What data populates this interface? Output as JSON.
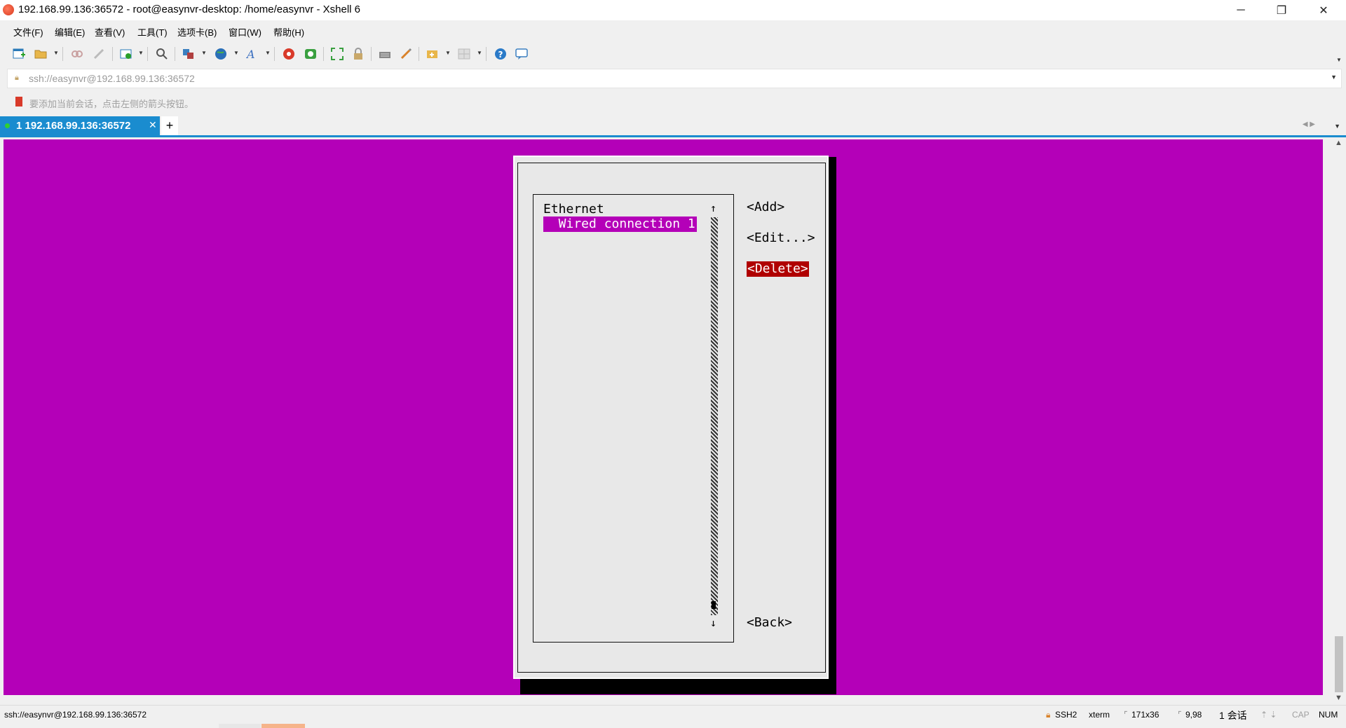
{
  "window": {
    "title": "192.168.99.136:36572 - root@easynvr-desktop: /home/easynvr - Xshell 6",
    "minimize_glyph": "─",
    "restore_glyph": "❐",
    "close_glyph": "✕"
  },
  "menu": {
    "items": [
      "文件(F)",
      "编辑(E)",
      "查看(V)",
      "工具(T)",
      "选项卡(B)",
      "窗口(W)",
      "帮助(H)"
    ]
  },
  "toolbar": {
    "icons": [
      "new-session-icon",
      "open-folder-icon",
      "reconnect-icon",
      "disconnect-icon",
      "properties-icon",
      "find-icon",
      "transfer-icon",
      "globe-icon",
      "font-icon",
      "xftp-icon",
      "xmanager-icon",
      "fullscreen-icon",
      "lock-icon",
      "keyboard-icon",
      "highlight-icon",
      "new-tab-icon",
      "layout-icon",
      "help-icon",
      "chat-icon"
    ]
  },
  "address_bar": {
    "value": "ssh://easynvr@192.168.99.136:36572"
  },
  "info_bar": {
    "text": "要添加当前会话，点击左侧的箭头按钮。"
  },
  "tabs": [
    {
      "label": "1 192.168.99.136:36572",
      "active": true
    }
  ],
  "tab_add_label": "+",
  "terminal": {
    "background_color": "#b400b8",
    "dialog": {
      "list_header": "Ethernet",
      "list_items": [
        "  Wired connection 1"
      ],
      "selected_index": 0,
      "scroll_up_glyph": "↑",
      "scroll_down_glyph": "↓",
      "buttons": {
        "add": "<Add>",
        "edit": "<Edit...>",
        "delete": "<Delete>",
        "back": "<Back>"
      },
      "focused_button": "delete",
      "focus_color": "#b00000"
    }
  },
  "status_bar": {
    "connection": "ssh://easynvr@192.168.99.136:36572",
    "protocol": "SSH2",
    "terminal_type": "xterm",
    "size": "171x36",
    "cursor": "9,98",
    "sessions": "1 会话",
    "caps": "CAP",
    "num": "NUM"
  }
}
